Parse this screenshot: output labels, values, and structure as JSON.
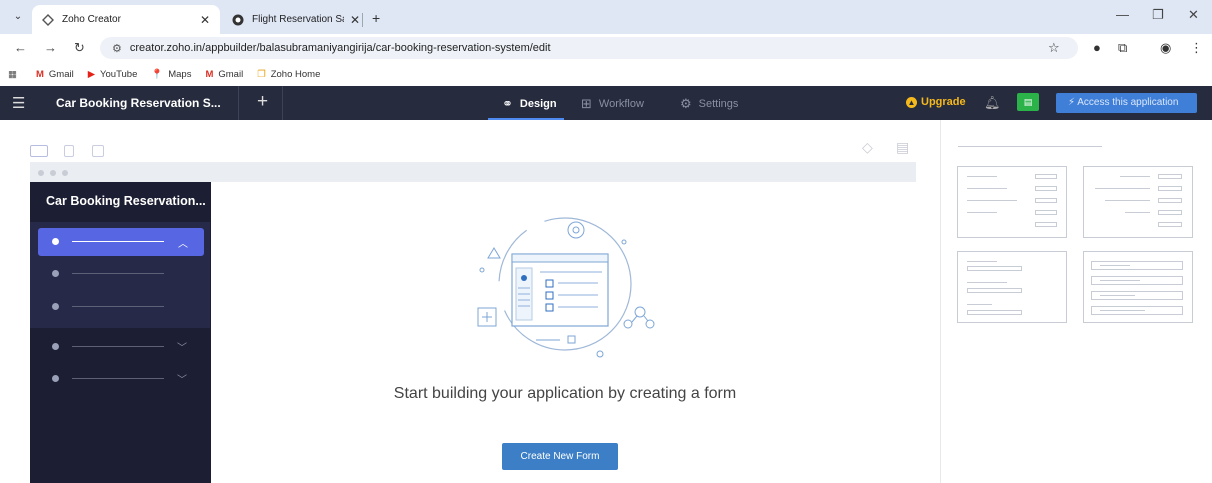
{
  "browser": {
    "tabs": [
      {
        "title": "Zoho Creator",
        "active": true
      },
      {
        "title": "Flight Reservation SaaS Forms",
        "active": false
      }
    ],
    "url": "creator.zoho.in/appbuilder/balasubramaniyangirija/car-booking-reservation-system/edit",
    "bookmarks": [
      {
        "label": "Gmail",
        "icon": "gmail-icon"
      },
      {
        "label": "YouTube",
        "icon": "youtube-icon"
      },
      {
        "label": "Maps",
        "icon": "maps-icon"
      },
      {
        "label": "Gmail",
        "icon": "gmail-icon"
      },
      {
        "label": "Zoho Home",
        "icon": "zoho-icon"
      }
    ]
  },
  "app": {
    "title": "Car Booking Reservation S...",
    "tabs": [
      {
        "label": "Design",
        "icon": "palette-icon",
        "active": true
      },
      {
        "label": "Workflow",
        "icon": "workflow-icon",
        "active": false
      },
      {
        "label": "Settings",
        "icon": "gear-icon",
        "active": false
      }
    ],
    "upgrade_label": "Upgrade",
    "access_label": "Access this application",
    "accent": "#4e8af0"
  },
  "preview": {
    "sidebar_title": "Car Booking Reservation...",
    "empty_message": "Start building your application by creating a form",
    "create_button": "Create New Form"
  },
  "colors": {
    "header_bg": "#262b3d",
    "sidebar_bg": "#1c1f33",
    "active_nav": "#5766e3",
    "create_button": "#3c7fc6",
    "access_button": "#3f7fd8",
    "green_button": "#2bb34a",
    "upgrade": "#f6b91c"
  }
}
